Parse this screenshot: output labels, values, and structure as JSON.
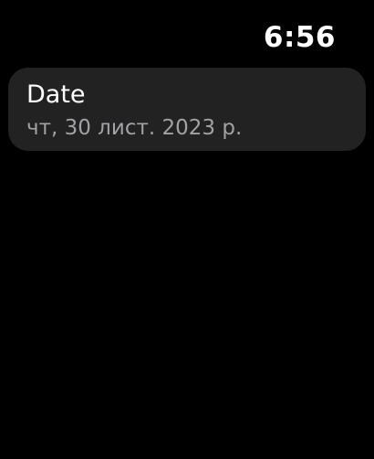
{
  "status_bar": {
    "time": "6:56"
  },
  "date_cell": {
    "title": "Date",
    "value": "чт, 30 лист. 2023 р."
  },
  "colors": {
    "background": "#000000",
    "cell_background": "#222222",
    "title_text": "#ffffff",
    "secondary_text": "#a1a1a6"
  }
}
